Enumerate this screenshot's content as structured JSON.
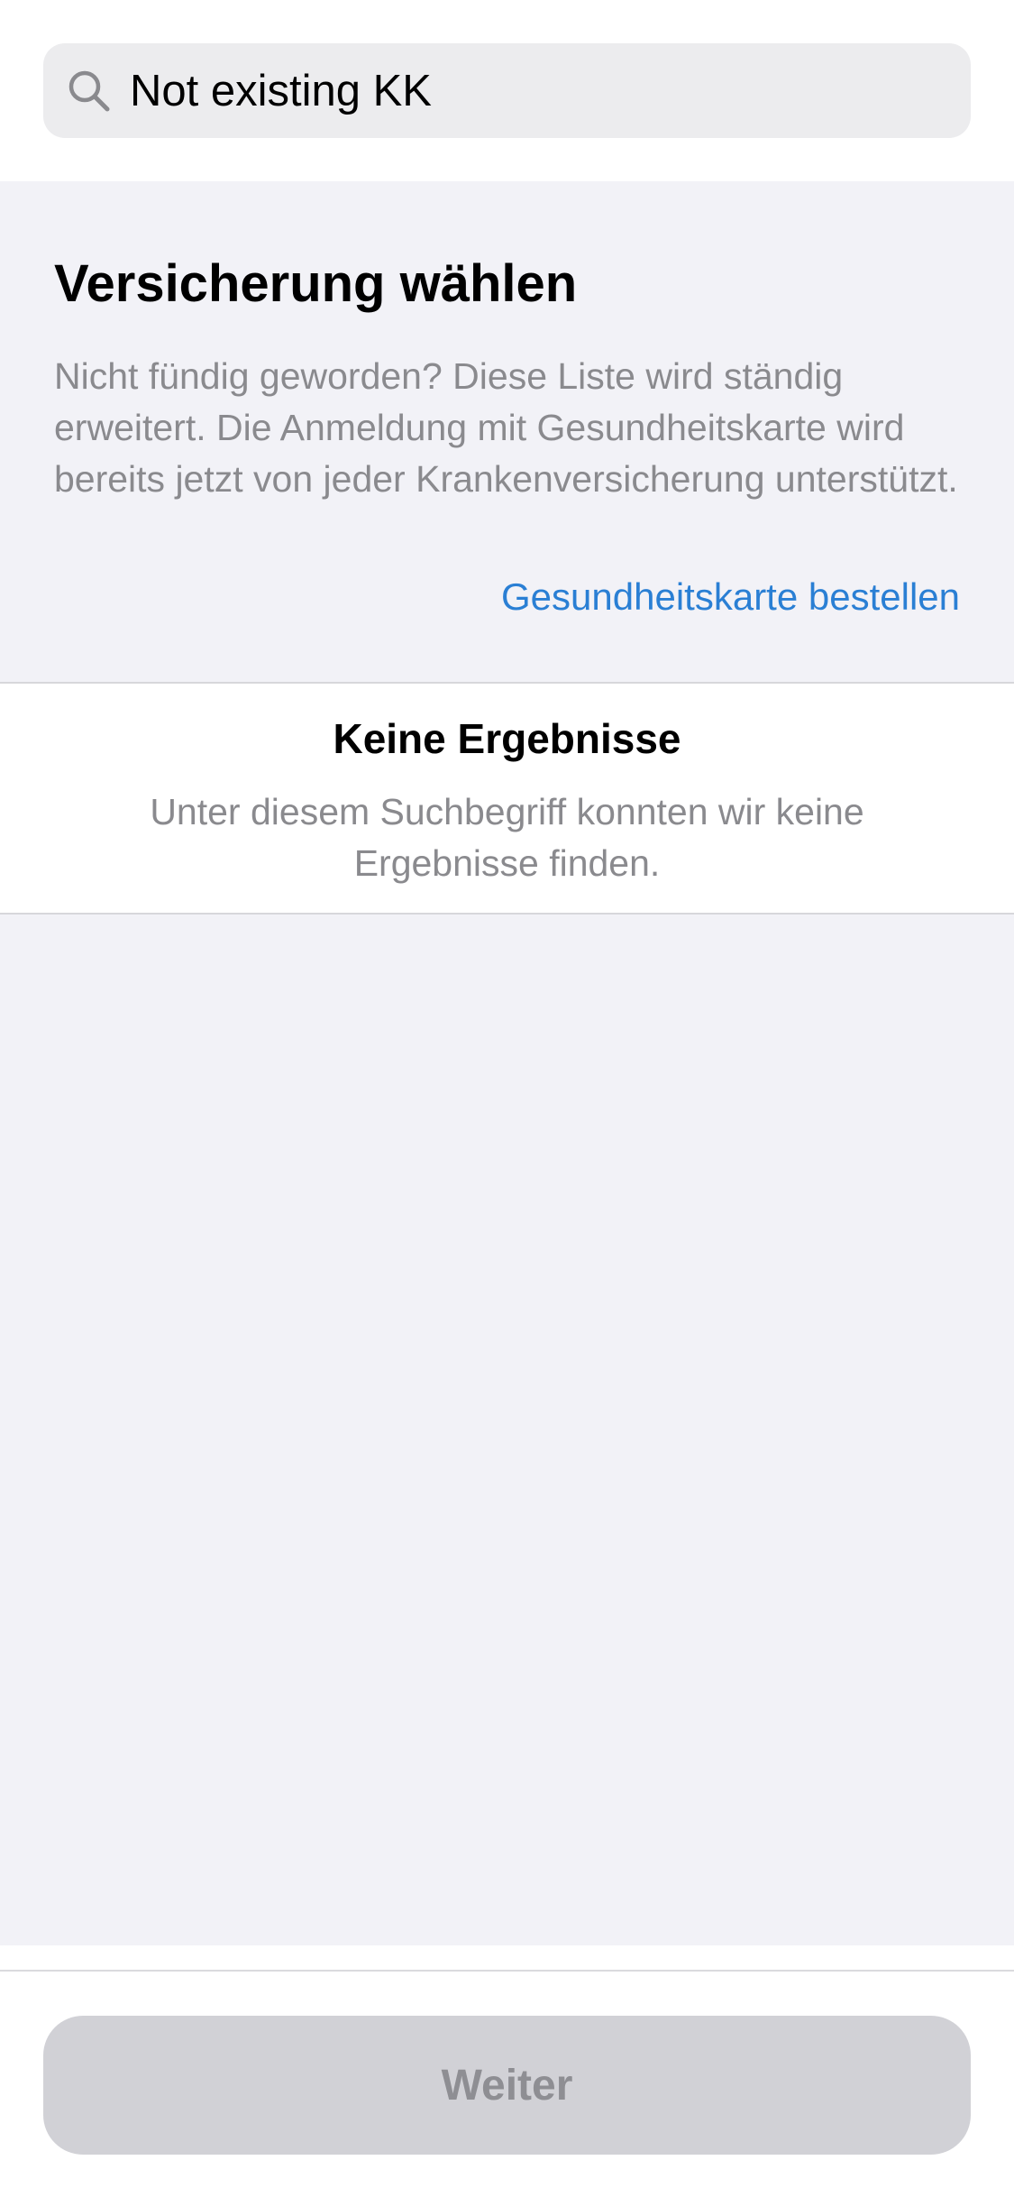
{
  "search": {
    "value": "Not existing KK",
    "icon": "search-icon"
  },
  "intro": {
    "title": "Versicherung wählen",
    "description": "Nicht fündig geworden? Diese Liste wird ständig erweitert. Die Anmeldung mit Gesundheitskarte wird bereits jetzt von jeder Krankenversicherung unterstützt.",
    "link_label": "Gesundheitskarte bestellen"
  },
  "empty_state": {
    "title": "Keine Ergebnisse",
    "message": "Unter diesem Suchbegriff konnten wir keine Ergebnisse finden."
  },
  "footer": {
    "next_label": "Weiter",
    "next_enabled": false
  },
  "colors": {
    "accent": "#2a7fd4",
    "background": "#f2f2f7",
    "secondary_text": "#8a8a8e",
    "disabled_button": "#d1d1d6"
  }
}
